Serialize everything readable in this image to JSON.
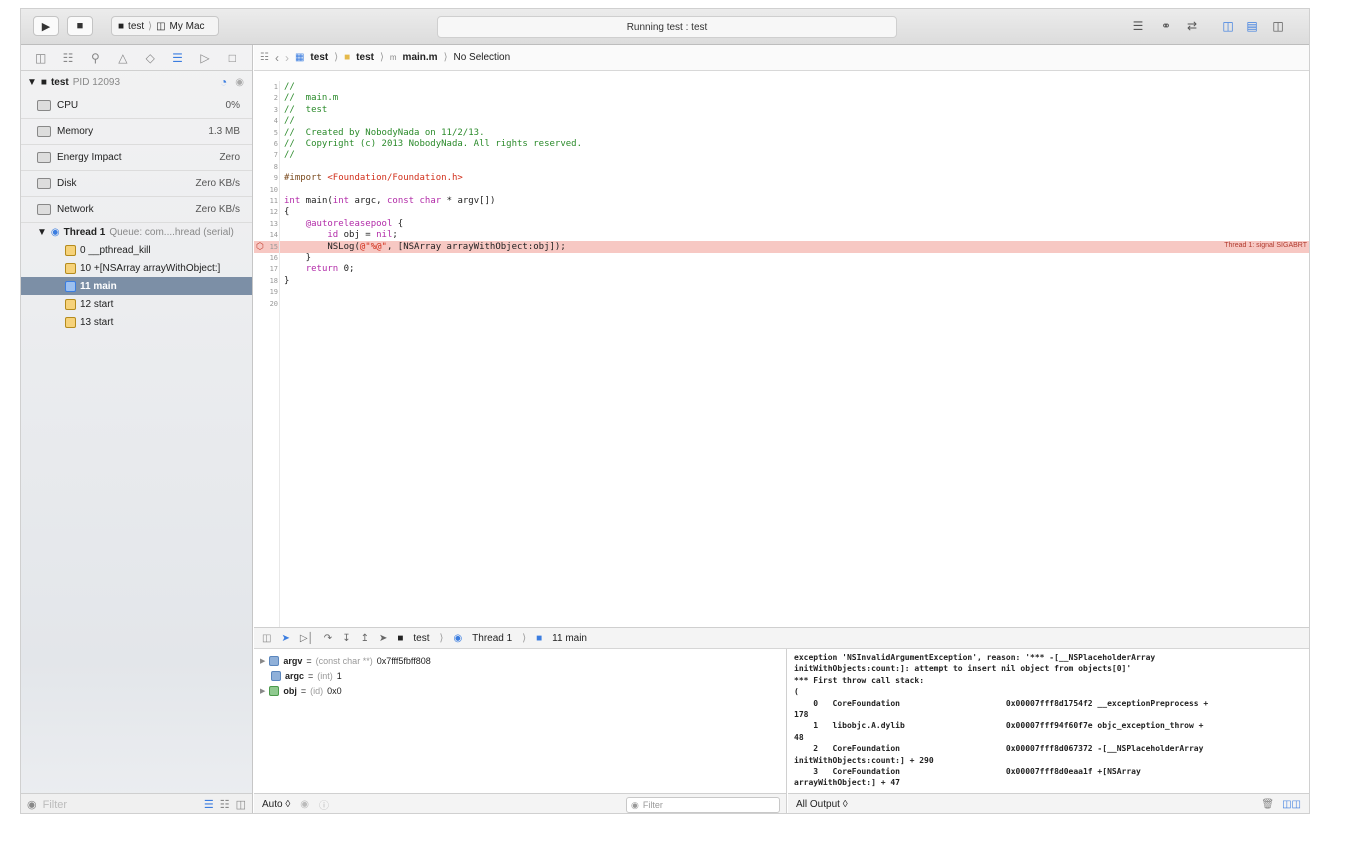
{
  "toolbar": {
    "scheme_target": "test",
    "scheme_device": "My Mac",
    "status_text": "Running test : test"
  },
  "navigator": {
    "process_name": "test",
    "process_pid": "PID 12093",
    "gauges": [
      {
        "label": "CPU",
        "value": "0%"
      },
      {
        "label": "Memory",
        "value": "1.3 MB"
      },
      {
        "label": "Energy Impact",
        "value": "Zero"
      },
      {
        "label": "Disk",
        "value": "Zero KB/s"
      },
      {
        "label": "Network",
        "value": "Zero KB/s"
      }
    ],
    "thread": "Thread 1",
    "thread_queue": "Queue: com....hread (serial)",
    "frames": [
      {
        "label": "0 __pthread_kill"
      },
      {
        "label": "10 +[NSArray arrayWithObject:]"
      },
      {
        "label": "11 main"
      },
      {
        "label": "12 start"
      },
      {
        "label": "13 start"
      }
    ],
    "filter_placeholder": "Filter"
  },
  "jumpbar": {
    "project": "test",
    "group": "test",
    "file": "main.m",
    "selection": "No Selection"
  },
  "editor": {
    "line_numbers": [
      "1",
      "2",
      "3",
      "4",
      "5",
      "6",
      "7",
      "8",
      "9",
      "10",
      "11",
      "12",
      "13",
      "14",
      "15",
      "16",
      "17",
      "18",
      "19",
      "20"
    ],
    "lines": [
      "//",
      "//  main.m",
      "//  test",
      "//",
      "//  Created by NobodyNada on 11/2/13.",
      "//  Copyright (c) 2013 NobodyNada. All rights reserved.",
      "//",
      "",
      "#import <Foundation/Foundation.h>",
      "",
      "int main(int argc, const char * argv[])",
      "{",
      "    @autoreleasepool {",
      "        id obj = nil;",
      "        NSLog(@\"%@\", [NSArray arrayWithObject:obj]);",
      "    }",
      "    return 0;",
      "}",
      "",
      ""
    ],
    "error_label": "Thread 1: signal SIGABRT"
  },
  "debugbar": {
    "project": "test",
    "thread": "Thread 1",
    "frame": "11 main"
  },
  "variables": [
    {
      "name": "argv",
      "type": "(const char **)",
      "value": "0x7fff5fbff808"
    },
    {
      "name": "argc",
      "type": "(int)",
      "value": "1"
    },
    {
      "name": "obj",
      "type": "(id)",
      "value": "0x0"
    }
  ],
  "variables_footer": {
    "mode": "Auto ◊",
    "filter_placeholder": "Filter"
  },
  "console": {
    "text": "exception 'NSInvalidArgumentException', reason: '*** -[__NSPlaceholderArray\ninitWithObjects:count:]: attempt to insert nil object from objects[0]'\n*** First throw call stack:\n(\n    0   CoreFoundation                      0x00007fff8d1754f2 __exceptionPreprocess +\n178\n    1   libobjc.A.dylib                     0x00007fff94f60f7e objc_exception_throw +\n48\n    2   CoreFoundation                      0x00007fff8d067372 -[__NSPlaceholderArray\ninitWithObjects:count:] + 290\n    3   CoreFoundation                      0x00007fff8d0eaa1f +[NSArray\narrayWithObject:] + 47",
    "output_mode": "All Output ◊"
  }
}
